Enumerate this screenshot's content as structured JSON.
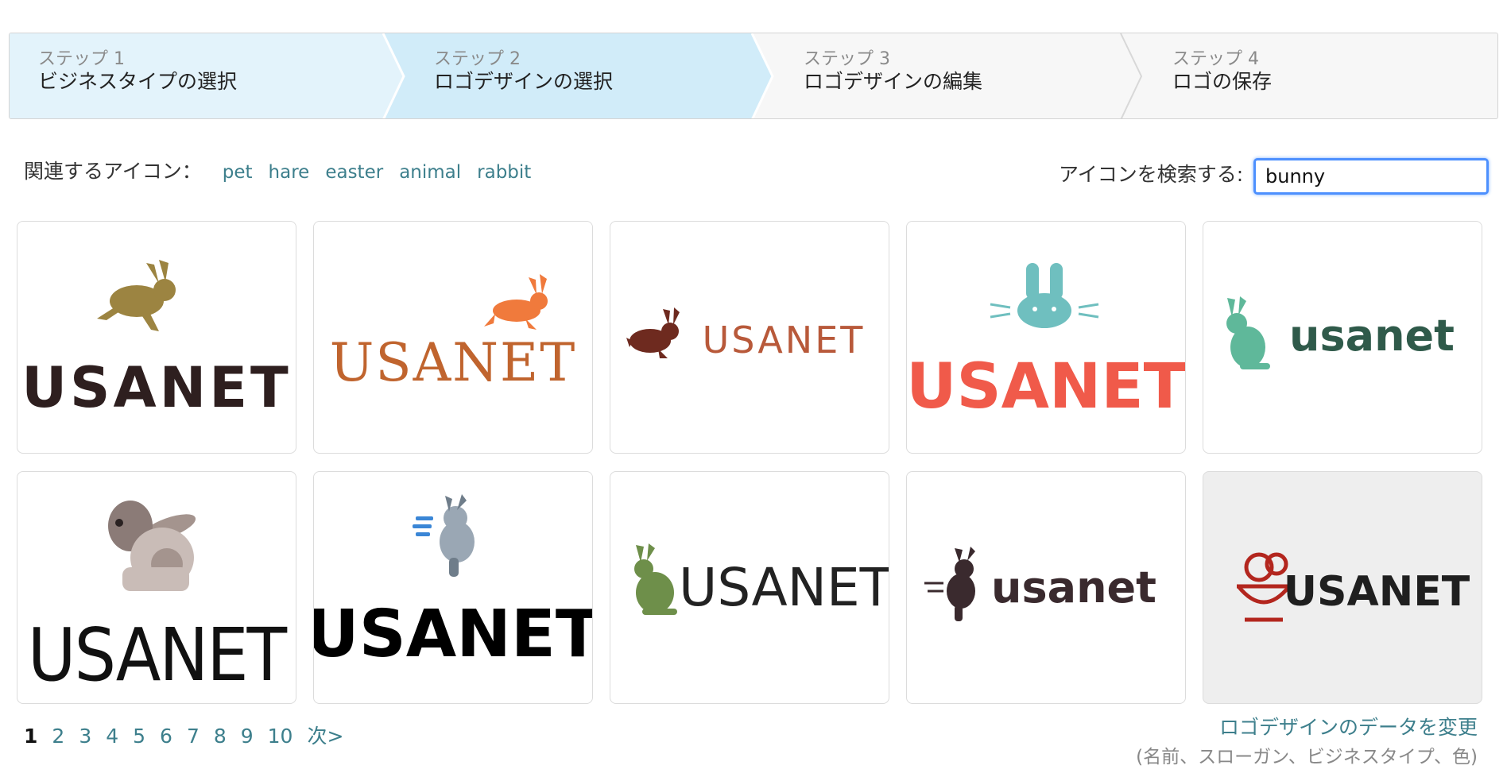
{
  "steps": [
    {
      "number": "ステップ 1",
      "title": "ビジネスタイプの選択"
    },
    {
      "number": "ステップ 2",
      "title": "ロゴデザインの選択"
    },
    {
      "number": "ステップ 3",
      "title": "ロゴデザインの編集"
    },
    {
      "number": "ステップ 4",
      "title": "ロゴの保存"
    }
  ],
  "related": {
    "label": "関連するアイコン：",
    "tags": [
      "pet",
      "hare",
      "easter",
      "animal",
      "rabbit"
    ]
  },
  "search": {
    "label": "アイコンを検索する:",
    "value": "bunny"
  },
  "logos": [
    {
      "text": "USANET",
      "icon": "running-rabbit-icon",
      "color": "#2e1f1f",
      "accent": "#9c8441"
    },
    {
      "text": "USANET",
      "icon": "leaping-rabbit-icon",
      "color": "#c0642e",
      "accent": "#f07a3c"
    },
    {
      "text": "USANET",
      "icon": "hopping-rabbit-icon",
      "color": "#b8593a",
      "accent": "#6e2a1f"
    },
    {
      "text": "USANET",
      "icon": "bunny-face-icon",
      "color": "#f05a4a",
      "accent": "#6fbfbf"
    },
    {
      "text": "usanet",
      "icon": "sitting-rabbit-icon",
      "color": "#2f5a4a",
      "accent": "#5fb89a"
    },
    {
      "text": "USANET",
      "icon": "sitting-rabbit-icon",
      "color": "#111111",
      "accent": "#b9a9a3"
    },
    {
      "text": "USANET",
      "icon": "speeding-rabbit-icon",
      "color": "#000000",
      "accent": "#9aa7b4"
    },
    {
      "text": "USANET",
      "icon": "sitting-rabbit-icon",
      "color": "#222222",
      "accent": "#6e8f4a"
    },
    {
      "text": "usanet",
      "icon": "dashing-rabbit-icon",
      "color": "#3a2a2e",
      "accent": "#3a2a2e"
    },
    {
      "text": "USANET",
      "icon": "rabbit-bowl-icon",
      "color": "#1f1f1f",
      "accent": "#b3261e"
    }
  ],
  "pagination": {
    "pages": [
      "1",
      "2",
      "3",
      "4",
      "5",
      "6",
      "7",
      "8",
      "9",
      "10"
    ],
    "current": "1",
    "next": "次>"
  },
  "change": {
    "link": "ロゴデザインのデータを変更",
    "note": "(名前、スローガン、ビジネスタイプ、色)"
  }
}
